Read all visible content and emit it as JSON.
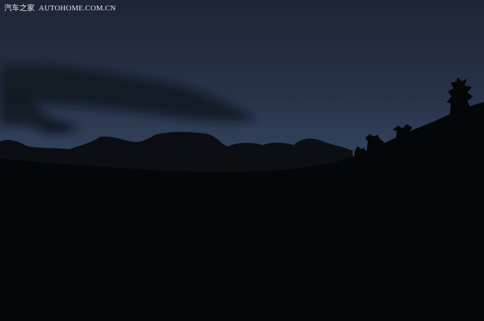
{
  "photo": {
    "subject": "dusk-mountain-silhouette",
    "colors": {
      "sky_top": "#1e2535",
      "sky_mid": "#27324a",
      "sky_horizon": "#34455e",
      "cloud": "#111520",
      "ground": "#050608"
    }
  },
  "watermark": {
    "brand_cn": "汽车之家",
    "domain": "AUTOHOME.COM.CN"
  }
}
